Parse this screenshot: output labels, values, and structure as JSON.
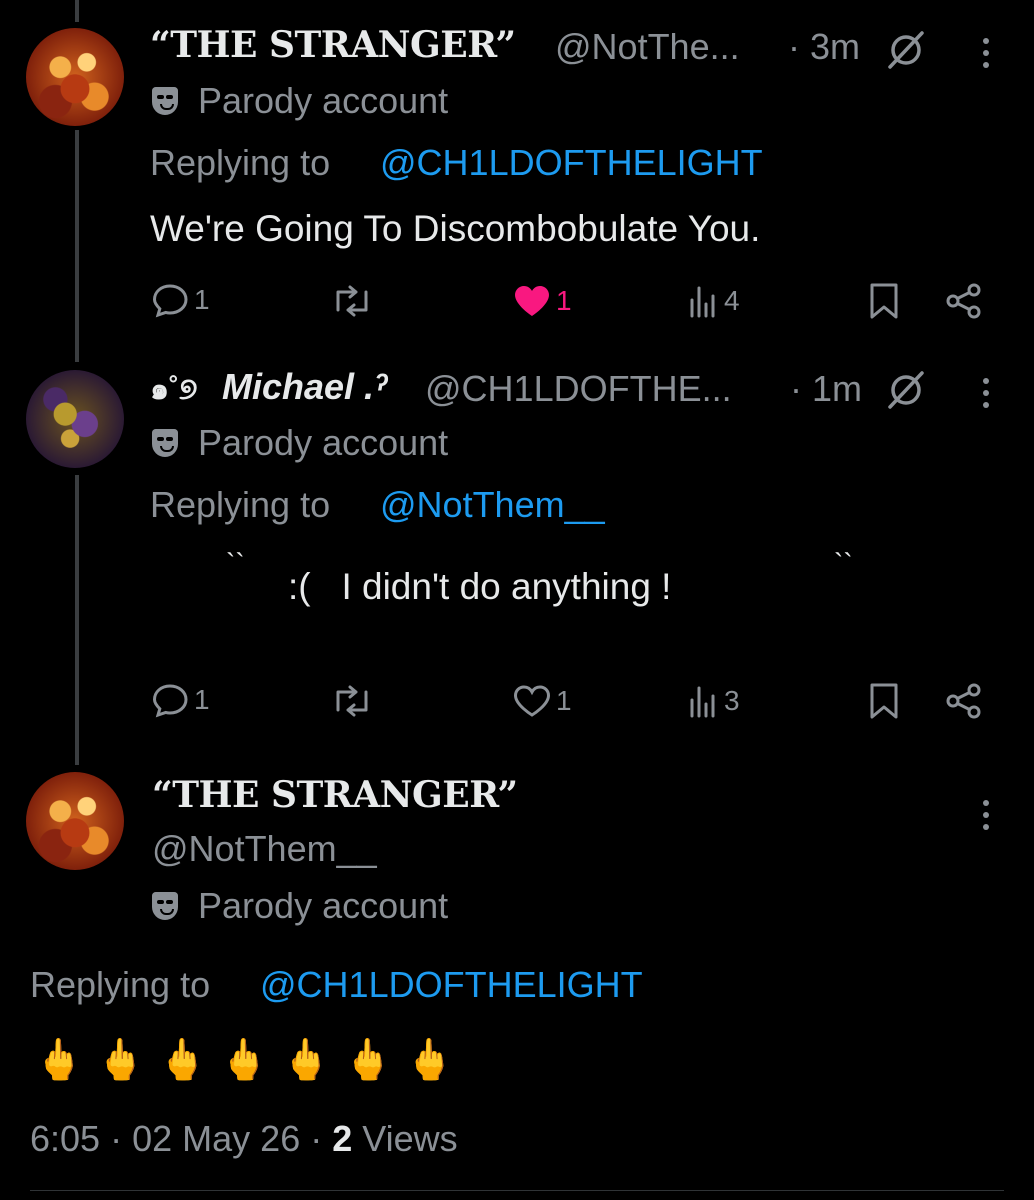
{
  "tweets": [
    {
      "display_name": "“THE STRANGER”",
      "handle": "@NotThe...",
      "time": "· 3m",
      "badge": "Parody account",
      "replying_label": "Replying to",
      "replying_to": "@CH1LDOFTHELIGHT",
      "text": "We're Going To Discombobulate You.",
      "replies": "1",
      "likes": "1",
      "liked": true,
      "views": "4"
    },
    {
      "display_name_prefix": "๑˚୭",
      "display_name": "Michael .ˀ",
      "handle": "@CH1LDOFTHE...",
      "time": "· 1m",
      "badge": "Parody account",
      "replying_label": "Replying to",
      "replying_to": "@NotThem__",
      "text_left": "``",
      "text": ":(   I didn't do anything !",
      "text_right": "``",
      "replies": "1",
      "likes": "1",
      "liked": false,
      "views": "3"
    }
  ],
  "main_tweet": {
    "display_name": "“THE STRANGER”",
    "handle": "@NotThem__",
    "badge": "Parody account",
    "replying_label": "Replying to",
    "replying_to": "@CH1LDOFTHELIGHT",
    "emojis": "🖕🖕🖕🖕🖕🖕🖕",
    "time": "6:05",
    "date": "02 May 26",
    "views_count": "2",
    "views_label": "Views",
    "separator": "·"
  },
  "colors": {
    "background": "#000000",
    "text": "#e7e9ea",
    "secondary": "#8b9096",
    "link": "#1d9bf0",
    "like": "#f91880"
  }
}
